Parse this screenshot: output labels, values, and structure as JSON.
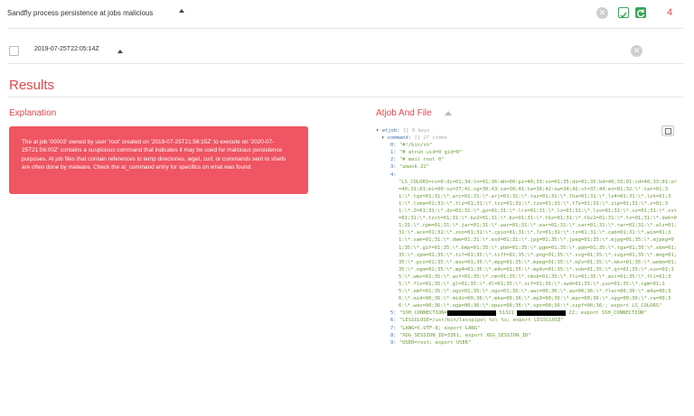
{
  "topbar": {
    "rule_select_value": "Sandfly process persistence at jobs malicious",
    "count": "4"
  },
  "result_row": {
    "timestamp": "2019-07-25T22:05:14Z"
  },
  "page": {
    "results_heading": "Results",
    "explanation_heading": "Explanation",
    "atjob_heading": "Atjob And File"
  },
  "explanation": {
    "text": "The at job '00003' owned by user 'root' created on '2019-07-25T21:56:15Z' to execute on '2020-07-25T21:56:00Z' contains a suspicious command that indicates it may be used for malicious persistence purposes. At job files that contain references to temp directories, wget, curl, or commands sent to shells are often done by malware. Check the at_command entry for specifics on what was found."
  },
  "tree": {
    "root_key": "atjob:",
    "root_meta": "{} 9 keys",
    "command_key": "command:",
    "command_meta": "[] 27 items",
    "items": [
      {
        "idx": "0:",
        "val": "\"#!/bin/sh\""
      },
      {
        "idx": "1:",
        "val": "\"# atrun uid=0 gid=0\""
      },
      {
        "idx": "2:",
        "val": "\"# mail root 0\""
      },
      {
        "idx": "3:",
        "val": "\"umask 22\""
      },
      {
        "idx": "4:",
        "val": ""
      }
    ],
    "ls_colors": "\"LS_COLORS=rs=0:di=01;34:ln=01;36:mh=00:pi=40;33:so=01;35:do=01;35:bd=40;33;01:cd=40;33;01:or=40;31;01:mi=00:su=37;41:sg=30;43:ca=30;41:tw=30;42:ow=34;42:st=37;44:ex=01;32:\\*.tar=01;31:\\*.tgz=01;31:\\*.arc=01;31:\\*.arj=01;31:\\*.taz=01;31:\\*.lha=01;31:\\*.lz4=01;31:\\*.lzh=01;31:\\*.lzma=01;31:\\*.tlz=01;31:\\*.txz=01;31:\\*.tzo=01;31:\\*.t7z=01;31:\\*.zip=01;31:\\*.z=01;31:\\*.Z=01;31:\\*.dz=01;31:\\*.gz=01;31:\\*.lrz=01;31:\\*.lz=01;31:\\*.lzo=01;31:\\*.xz=01;31:\\*.zst=01;31:\\*.tzst=01;31:\\*.bz2=01;31:\\*.bz=01;31:\\*.tbz=01;31:\\*.tbz2=01;31:\\*.tz=01;31:\\*.deb=01;31:\\*.rpm=01;31:\\*.jar=01;31:\\*.war=01;31:\\*.ear=01;31:\\*.sar=01;31:\\*.rar=01;31:\\*.alz=01;31:\\*.ace=01;31:\\*.zoo=01;31:\\*.cpio=01;31:\\*.7z=01;31:\\*.rz=01;31:\\*.cab=01;31:\\*.wim=01;31:\\*.swm=01;31:\\*.dwm=01;31:\\*.esd=01;31:\\*.jpg=01;35:\\*.jpeg=01;35:\\*.mjpg=01;35:\\*.mjpeg=01;35:\\*.gif=01;35:\\*.bmp=01;35:\\*.pbm=01;35:\\*.pgm=01;35:\\*.ppm=01;35:\\*.tga=01;35:\\*.xbm=01;35:\\*.xpm=01;35:\\*.tif=01;35:\\*.tiff=01;35:\\*.png=01;35:\\*.svg=01;35:\\*.svgz=01;35:\\*.mng=01;35:\\*.pcx=01;35:\\*.mov=01;35:\\*.mpg=01;35:\\*.mpeg=01;35:\\*.m2v=01;35:\\*.mkv=01;35:\\*.webm=01;35:\\*.ogm=01;35:\\*.mp4=01;35:\\*.m4v=01;35:\\*.mp4v=01;35:\\*.vob=01;35:\\*.qt=01;35:\\*.nuv=01;35:\\*.wmv=01;35:\\*.asf=01;35:\\*.rm=01;35:\\*.rmvb=01;35:\\*.flc=01;35:\\*.avi=01;35:\\*.fli=01;35:\\*.flv=01;35:\\*.gl=01;35:\\*.dl=01;35:\\*.xcf=01;35:\\*.xwd=01;35:\\*.yuv=01;35:\\*.cgm=01;35:\\*.emf=01;35:\\*.ogv=01;35:\\*.ogx=01;35:\\*.aac=00;36:\\*.au=00;36:\\*.flac=00;36:\\*.m4a=00;36:\\*.mid=00;36:\\*.midi=00;36:\\*.mka=00;36:\\*.mp3=00;36:\\*.mpc=00;36:\\*.ogg=00;36:\\*.ra=00;36:\\*.wav=00;36:\\*.oga=00;36:\\*.opus=00;36:\\*.spx=00;36:\\*.xspf=00;36:; export LS_COLORS\"",
    "item5_idx": "5:",
    "item5_part1": "\"SSH_CONNECTION=",
    "item5_part2": " 51321 ",
    "item5_part3": " 22; export SSH_CONNECTION\"",
    "items_after": [
      {
        "idx": "6:",
        "val": "\"LESSCLOSE=/usr/bin/lesspipe\\ %s\\ %s; export LESSCLOSE\""
      },
      {
        "idx": "7:",
        "val": "\"LANG=C.UTF-8; export LANG\""
      },
      {
        "idx": "8:",
        "val": "\"XDG_SESSION_ID=3361; export XDG_SESSION_ID\""
      },
      {
        "idx": "9:",
        "val": "\"USER=root; export USER\""
      }
    ]
  },
  "colors": {
    "accent_red": "#e0474f",
    "alert_bg": "#ef5562",
    "check_green": "#3aa55a"
  },
  "icons": {
    "clear": "close-circle-icon",
    "checklist": "checklist-icon",
    "refresh": "refresh-icon",
    "copy": "copy-icon",
    "collapse": "caret-down-icon",
    "sort": "caret-up-icon"
  }
}
